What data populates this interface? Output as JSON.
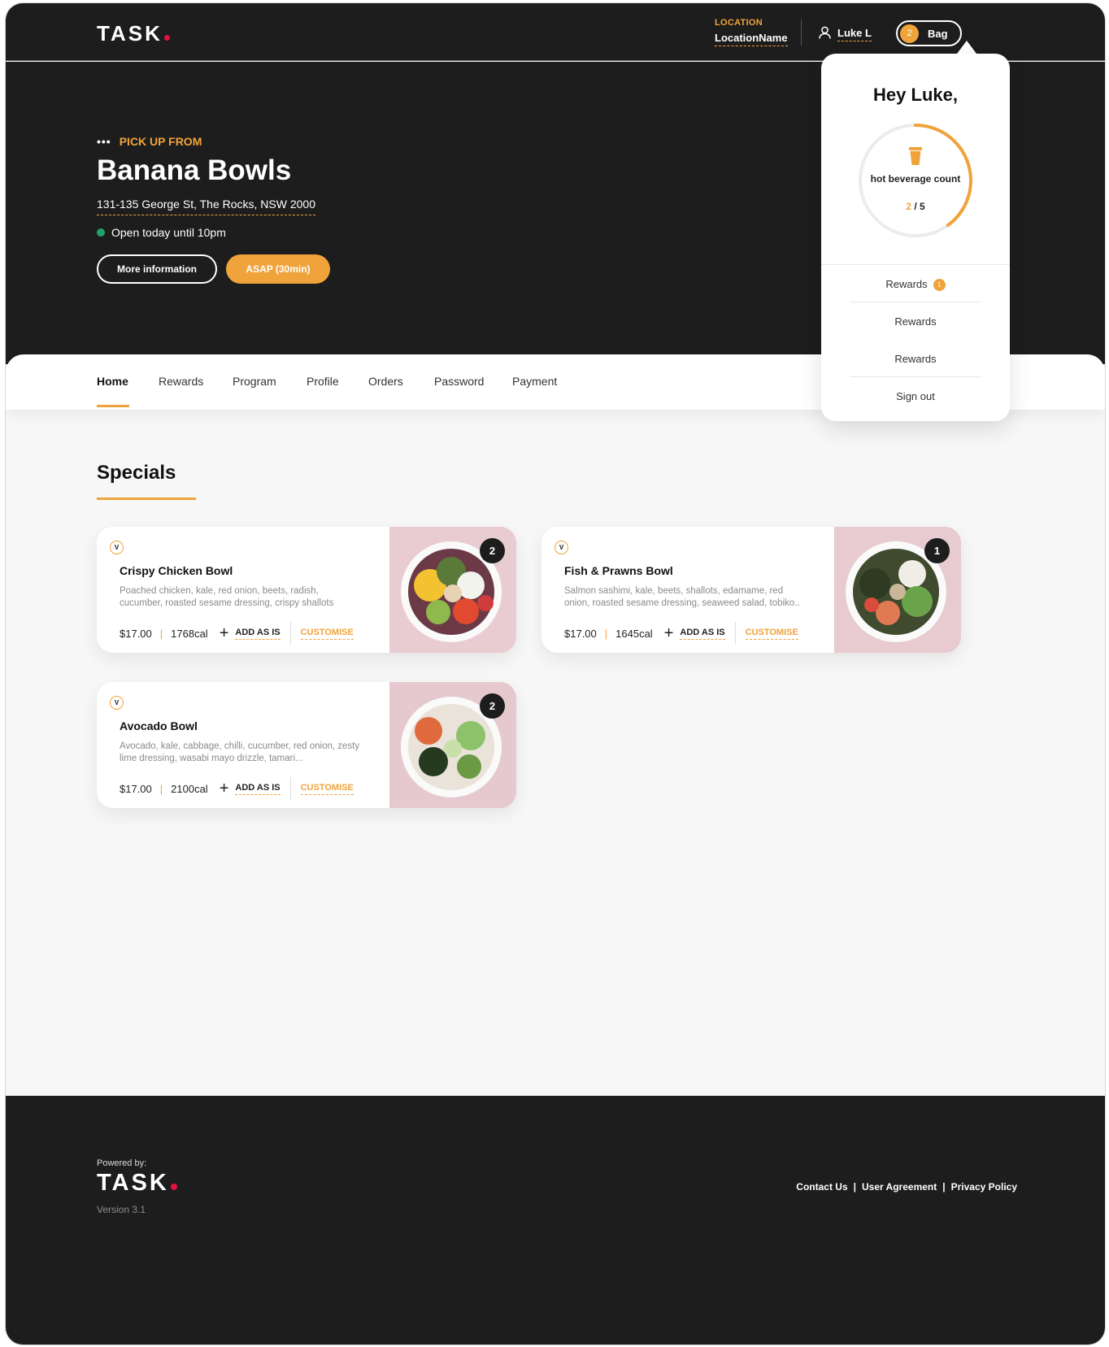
{
  "header": {
    "logo": "TASK",
    "location_label": "LOCATION",
    "location_value": "LocationName",
    "user_name": "Luke L",
    "bag_count": "2",
    "bag_label": "Bag"
  },
  "hero": {
    "pick_label": "PICK UP FROM",
    "store_name": "Banana Bowls",
    "address": "131-135 George St, The Rocks, NSW 2000",
    "hours": "Open today until 10pm",
    "more_info_label": "More information",
    "asap_label": "ASAP (30min)"
  },
  "nav": {
    "tabs": [
      {
        "label": "Home",
        "active": true
      },
      {
        "label": "Rewards"
      },
      {
        "label": "Program"
      },
      {
        "label": "Profile"
      },
      {
        "label": "Orders"
      },
      {
        "label": "Password"
      },
      {
        "label": "Payment"
      }
    ]
  },
  "specials": {
    "title": "Specials",
    "items": [
      {
        "badge": "V",
        "title": "Crispy Chicken Bowl",
        "desc": "Poached chicken, kale, red onion, beets, radish, cucumber, roasted sesame dressing, crispy shallots",
        "price": "$17.00",
        "cal": "1768cal",
        "add_label": "ADD AS IS",
        "customise_label": "CUSTOMISE",
        "qty": "2"
      },
      {
        "badge": "V",
        "title": "Fish & Prawns Bowl",
        "desc": "Salmon sashimi, kale, beets, shallots, edamame, red onion, roasted sesame dressing, seaweed salad, tobiko..",
        "price": "$17.00",
        "cal": "1645cal",
        "add_label": "ADD AS IS",
        "customise_label": "CUSTOMISE",
        "qty": "1"
      },
      {
        "badge": "V",
        "title": "Avocado Bowl",
        "desc": "Avocado, kale, cabbage, chilli, cucumber, red onion, zesty lime dressing, wasabi mayo drizzle, tamari...",
        "price": "$17.00",
        "cal": "2100cal",
        "add_label": "ADD AS IS",
        "customise_label": "CUSTOMISE",
        "qty": "2"
      }
    ]
  },
  "dropdown": {
    "greeting": "Hey Luke,",
    "counter_label": "hot beverage count",
    "counter_current": "2",
    "counter_sep": " / ",
    "counter_total": "5",
    "counter_fraction": 0.4,
    "items": [
      {
        "label": "Rewards",
        "badge": "1"
      },
      {
        "label": "Rewards"
      },
      {
        "label": "Rewards"
      },
      {
        "label": "Sign out"
      }
    ]
  },
  "footer": {
    "powered_by": "Powered by:",
    "logo": "TASK",
    "version": "Version 3.1",
    "links": [
      "Contact Us",
      "User Agreement",
      "Privacy Policy"
    ],
    "separator": "|"
  },
  "colors": {
    "accent": "#f0a33a",
    "dark": "#1d1d1d",
    "brand_dot": "#e3123f",
    "open_status": "#1fa36b"
  },
  "icons": [
    "user-icon",
    "cup-icon",
    "plus-icon",
    "dots-icon"
  ]
}
